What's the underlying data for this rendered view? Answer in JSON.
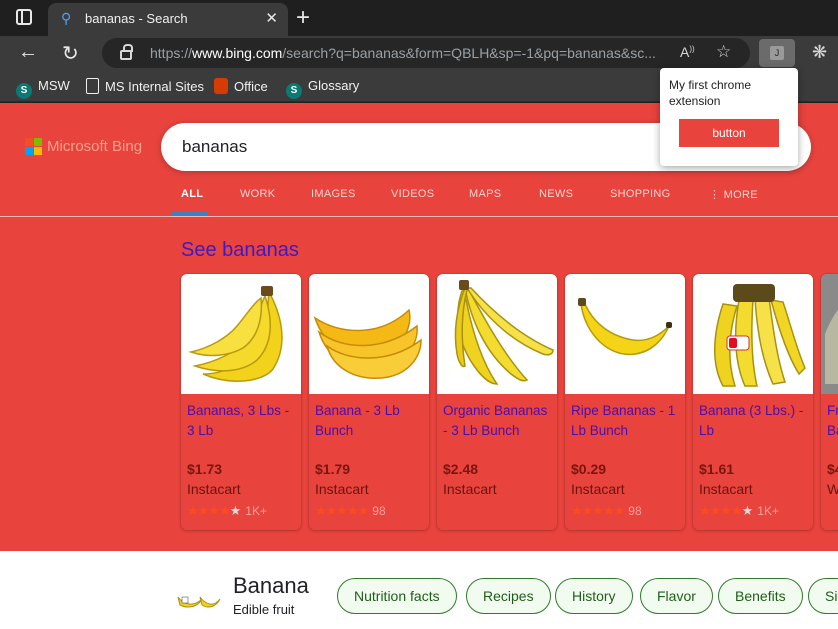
{
  "browser": {
    "tab": {
      "title": "bananas - Search"
    },
    "address": {
      "url_prefix": "https://",
      "url_domain": "www.bing.com",
      "url_path": "/search?q=bananas&form=QBLH&sp=-1&pq=bananas&sc..."
    },
    "extension_icon_letter": "J",
    "bookmarks": [
      {
        "label": "MSW",
        "icon": "sharepoint-icon",
        "icon_letter": "S"
      },
      {
        "label": "MS Internal Sites",
        "icon": "document-icon",
        "icon_letter": ""
      },
      {
        "label": "Office",
        "icon": "office-icon",
        "icon_letter": ""
      },
      {
        "label": "Glossary",
        "icon": "sharepoint-icon",
        "icon_letter": "S"
      }
    ]
  },
  "popup": {
    "text": "My first chrome extension",
    "button_label": "button"
  },
  "bing": {
    "logo_text": "Microsoft Bing",
    "search_query": "bananas",
    "scopes": [
      "ALL",
      "WORK",
      "IMAGES",
      "VIDEOS",
      "MAPS",
      "NEWS",
      "SHOPPING",
      "⋮ MORE"
    ],
    "see_title": "See bananas",
    "products": [
      {
        "name": "Bananas, 3 Lbs - 3 Lb",
        "price": "$1.73",
        "store": "Instacart",
        "stars": "★★★★",
        "empty_stars": "★",
        "rating_count": "1K+"
      },
      {
        "name": "Banana - 3 Lb Bunch",
        "price": "$1.79",
        "store": "Instacart",
        "stars": "★★★★★",
        "empty_stars": "",
        "rating_count": "98"
      },
      {
        "name": "Organic Bananas - 3 Lb Bunch",
        "price": "$2.48",
        "store": "Instacart",
        "stars": "",
        "empty_stars": "",
        "rating_count": ""
      },
      {
        "name": "Ripe Bananas - 1 Lb Bunch",
        "price": "$0.29",
        "store": "Instacart",
        "stars": "★★★★★",
        "empty_stars": "",
        "rating_count": "98"
      },
      {
        "name": "Banana (3 Lbs.) - Lb",
        "price": "$1.61",
        "store": "Instacart",
        "stars": "★★★★",
        "empty_stars": "★",
        "rating_count": "1K+"
      },
      {
        "name": "Fr Ba",
        "price": "$4",
        "store": "W",
        "stars": "",
        "empty_stars": "",
        "rating_count": ""
      }
    ],
    "entity": {
      "title": "Banana",
      "subtitle": "Edible fruit",
      "chips": [
        "Nutrition facts",
        "Recipes",
        "History",
        "Flavor",
        "Benefits",
        "Si"
      ]
    }
  },
  "colors": {
    "page_bg": "#e8433d",
    "banana_yellow": "#f2d21b",
    "chip_border": "#2d7d27"
  }
}
